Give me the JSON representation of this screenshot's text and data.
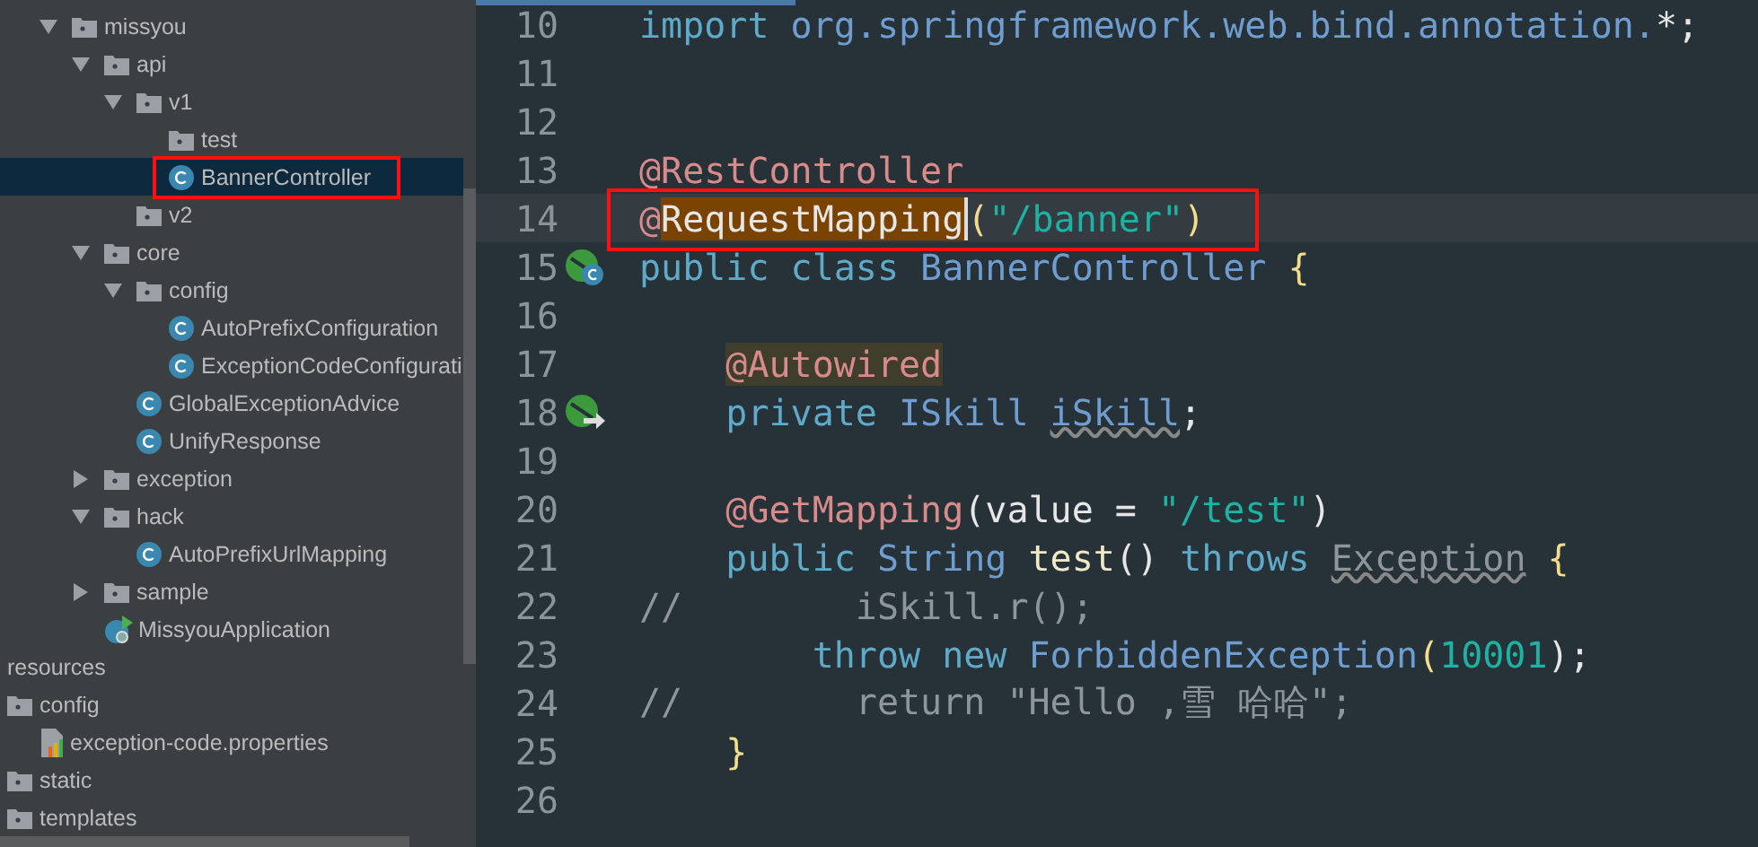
{
  "project_tree": {
    "source_items": [
      {
        "label": "missyou",
        "kind": "folder",
        "expanded": true,
        "selected": false,
        "children": [
          {
            "label": "api",
            "kind": "folder",
            "expanded": true,
            "selected": false,
            "children": [
              {
                "label": "v1",
                "kind": "folder",
                "expanded": true,
                "selected": false,
                "children": [
                  {
                    "label": "test",
                    "kind": "folder",
                    "selected": false
                  },
                  {
                    "label": "BannerController",
                    "kind": "class",
                    "selected": true,
                    "framed": true
                  }
                ]
              },
              {
                "label": "v2",
                "kind": "folder",
                "selected": false
              }
            ]
          },
          {
            "label": "core",
            "kind": "folder",
            "expanded": true,
            "selected": false,
            "children": [
              {
                "label": "config",
                "kind": "folder",
                "expanded": true,
                "selected": false,
                "children": [
                  {
                    "label": "AutoPrefixConfiguration",
                    "kind": "class",
                    "selected": false
                  },
                  {
                    "label": "ExceptionCodeConfigurati",
                    "kind": "class",
                    "selected": false
                  }
                ]
              },
              {
                "label": "GlobalExceptionAdvice",
                "kind": "class",
                "selected": false
              },
              {
                "label": "UnifyResponse",
                "kind": "class",
                "selected": false
              }
            ]
          },
          {
            "label": "exception",
            "kind": "folder",
            "expanded": false,
            "selected": false
          },
          {
            "label": "hack",
            "kind": "folder",
            "expanded": true,
            "selected": false,
            "children": [
              {
                "label": "AutoPrefixUrlMapping",
                "kind": "class",
                "selected": false
              }
            ]
          },
          {
            "label": "sample",
            "kind": "folder",
            "expanded": false,
            "selected": false
          },
          {
            "label": "MissyouApplication",
            "kind": "application",
            "selected": false
          }
        ]
      }
    ],
    "resource_items": [
      {
        "label": "resources",
        "kind": "plain",
        "selected": false
      },
      {
        "label": "config",
        "kind": "folder",
        "selected": false,
        "children": [
          {
            "label": "exception-code.properties",
            "kind": "properties",
            "selected": false
          }
        ]
      },
      {
        "label": "static",
        "kind": "folder",
        "selected": false
      },
      {
        "label": "templates",
        "kind": "folder",
        "selected": false
      }
    ]
  },
  "editor": {
    "lines": [
      {
        "number": "10",
        "tokens": [
          {
            "text": "import",
            "kind": "keyword"
          },
          {
            "text": " org.springframework.web.bind.annotation.",
            "kind": "type"
          },
          {
            "text": "*;",
            "kind": "plain"
          }
        ]
      },
      {
        "number": "11"
      },
      {
        "number": "12"
      },
      {
        "number": "13",
        "tokens": [
          {
            "text": "@RestController",
            "kind": "annotation"
          }
        ]
      },
      {
        "number": "14",
        "current": true,
        "framed": true,
        "tokens": [
          {
            "text": "@",
            "kind": "annotation"
          },
          {
            "text": "RequestMapping",
            "kind": "plain",
            "highlighted": true,
            "caret": true
          },
          {
            "text": "(",
            "kind": "brace"
          },
          {
            "text": "\"/banner\"",
            "kind": "string"
          },
          {
            "text": ")",
            "kind": "brace"
          }
        ]
      },
      {
        "number": "15",
        "gutter_marker": {
          "kind": "class"
        },
        "tokens": [
          {
            "text": "public class ",
            "kind": "keyword"
          },
          {
            "text": "BannerController ",
            "kind": "type"
          },
          {
            "text": "{",
            "kind": "brace"
          }
        ]
      },
      {
        "number": "16"
      },
      {
        "number": "17",
        "tokens": [
          {
            "text": "    @Autowired",
            "kind": "annotation",
            "highlighted": true
          }
        ]
      },
      {
        "number": "18",
        "gutter_marker": {
          "kind": "injection"
        },
        "tokens": [
          {
            "text": "    private ",
            "kind": "keyword"
          },
          {
            "text": "ISkill ",
            "kind": "type"
          },
          {
            "text": "iSkill",
            "kind": "field",
            "wavy": true
          },
          {
            "text": ";",
            "kind": "plain"
          }
        ]
      },
      {
        "number": "19"
      },
      {
        "number": "20",
        "tokens": [
          {
            "text": "    @GetMapping",
            "kind": "annotation"
          },
          {
            "text": "(value = ",
            "kind": "plain"
          },
          {
            "text": "\"/test\"",
            "kind": "string"
          },
          {
            "text": ")",
            "kind": "plain"
          }
        ]
      },
      {
        "number": "21",
        "tokens": [
          {
            "text": "    public ",
            "kind": "keyword"
          },
          {
            "text": "String ",
            "kind": "type"
          },
          {
            "text": "test",
            "kind": "method"
          },
          {
            "text": "() ",
            "kind": "plain"
          },
          {
            "text": "throws ",
            "kind": "keyword"
          },
          {
            "text": "Exception",
            "kind": "comment",
            "wavy": true
          },
          {
            "text": " {",
            "kind": "brace"
          }
        ]
      },
      {
        "number": "22",
        "tokens": [
          {
            "text": "//        iSkill.r();",
            "kind": "comment"
          }
        ]
      },
      {
        "number": "23",
        "tokens": [
          {
            "text": "        throw new ",
            "kind": "keyword"
          },
          {
            "text": "ForbiddenException",
            "kind": "type"
          },
          {
            "text": "(",
            "kind": "brace"
          },
          {
            "text": "10001",
            "kind": "number"
          },
          {
            "text": ");",
            "kind": "plain"
          }
        ]
      },
      {
        "number": "24",
        "tokens": [
          {
            "text": "//        return \"Hello ,雪 哈哈\";",
            "kind": "comment"
          }
        ]
      },
      {
        "number": "25",
        "tokens": [
          {
            "text": "    }",
            "kind": "brace"
          }
        ]
      },
      {
        "number": "26"
      }
    ]
  }
}
